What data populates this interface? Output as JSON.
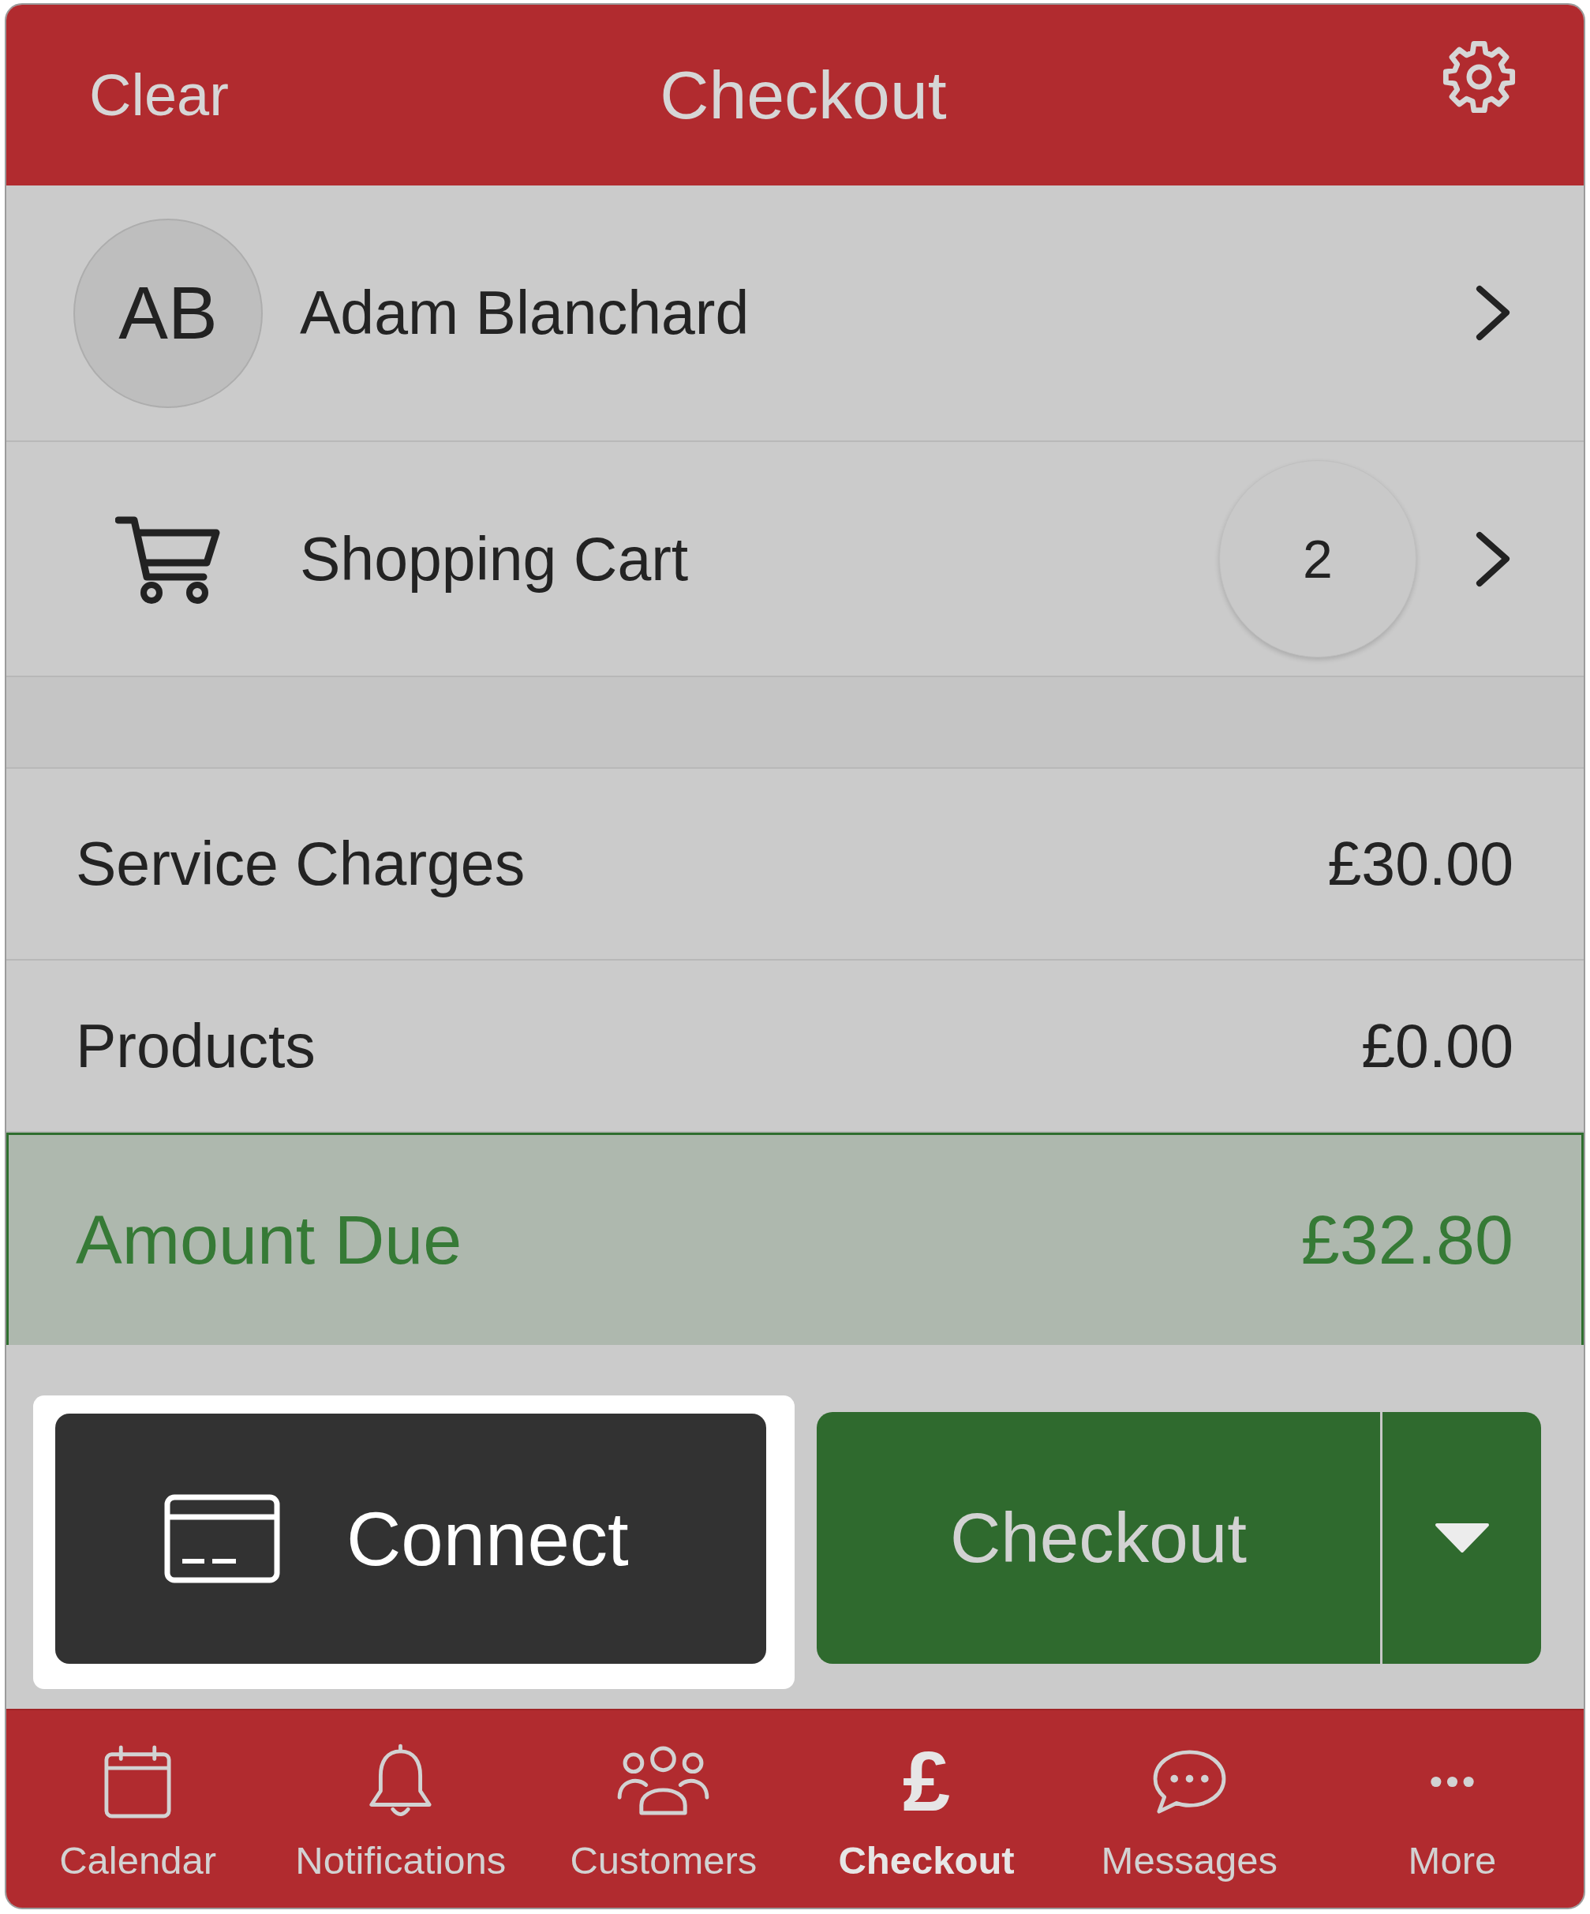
{
  "header": {
    "left_action": "Clear",
    "title": "Checkout"
  },
  "customer": {
    "initials": "AB",
    "name": "Adam Blanchard"
  },
  "cart": {
    "label": "Shopping Cart",
    "count": "2"
  },
  "summary": [
    {
      "kind": "line",
      "label": "Service Charges",
      "value": "£30.00"
    },
    {
      "kind": "line",
      "label": "Products",
      "value": "£0.00"
    },
    {
      "kind": "total",
      "label": "Amount Due",
      "value": "£32.80"
    }
  ],
  "actions": {
    "connect": {
      "label": "Connect",
      "focused": true
    },
    "checkout": {
      "label": "Checkout"
    }
  },
  "tab_bar": [
    {
      "label": "Calendar",
      "selected": false
    },
    {
      "label": "Notifications",
      "selected": false
    },
    {
      "label": "Customers",
      "selected": false
    },
    {
      "label": "Checkout",
      "symbol": "£",
      "selected": true
    },
    {
      "label": "Messages",
      "selected": false
    },
    {
      "label": "More",
      "selected": false
    }
  ]
}
